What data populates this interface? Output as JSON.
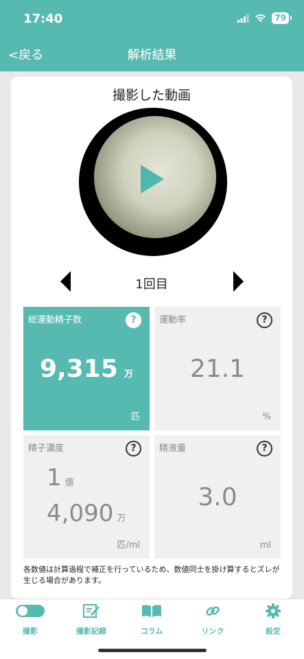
{
  "status": {
    "time": "17:40",
    "battery": "79"
  },
  "nav": {
    "back_label": "<戻る",
    "title": "解析結果"
  },
  "video": {
    "title": "撮影した動画"
  },
  "round": {
    "label": "1回目"
  },
  "metrics": {
    "total_motile": {
      "label": "総運動精子数",
      "value": "9,315",
      "value_unit": "万",
      "unit": "匹"
    },
    "motility_rate": {
      "label": "運動率",
      "value": "21.1",
      "unit": "%"
    },
    "concentration": {
      "label": "精子濃度",
      "value_line1": "1",
      "value_line1_unit": "億",
      "value_line2": "4,090",
      "value_line2_unit": "万",
      "unit": "匹/ml"
    },
    "volume": {
      "label": "精液量",
      "value": "3.0",
      "unit": "ml"
    }
  },
  "help_mark": "?",
  "note": "各数値は計算過程で補正を行っているため、数値同士を掛け算するとズレが生じる場合があります。",
  "tabs": [
    {
      "label": "撮影",
      "icon": "camera-toggle-icon"
    },
    {
      "label": "撮影記録",
      "icon": "edit-record-icon"
    },
    {
      "label": "コラム",
      "icon": "book-icon"
    },
    {
      "label": "リンク",
      "icon": "link-icon"
    },
    {
      "label": "設定",
      "icon": "gear-icon"
    }
  ],
  "colors": {
    "accent": "#57bab1",
    "tile_bg": "#f0f0f0",
    "muted_text": "#8a8a8a"
  }
}
